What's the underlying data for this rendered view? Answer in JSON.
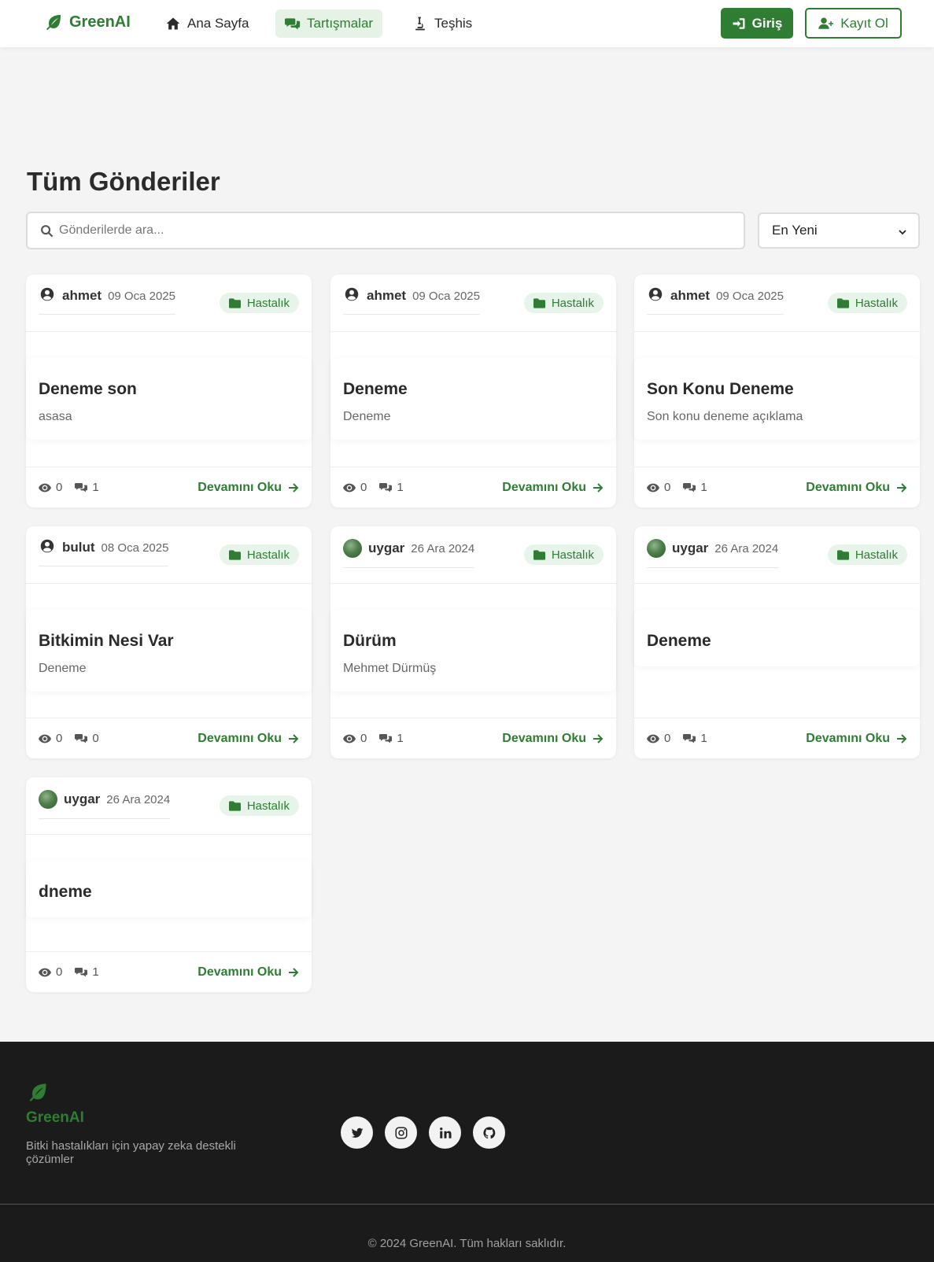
{
  "nav": {
    "brand": "GreenAI",
    "items": [
      {
        "label": "Ana Sayfa",
        "icon": "home-icon"
      },
      {
        "label": "Tartışmalar",
        "icon": "comments-icon",
        "active": true
      },
      {
        "label": "Teşhis",
        "icon": "microscope-icon"
      }
    ],
    "login_label": "Giriş",
    "register_label": "Kayıt Ol"
  },
  "page": {
    "title": "Tüm Gönderiler",
    "search_placeholder": "Gönderilerde ara...",
    "sort_selected": "En Yeni"
  },
  "posts": [
    {
      "author": "ahmet",
      "date": "09 Oca 2025",
      "category": "Hastalık",
      "title": "Deneme son",
      "desc": "asasa",
      "views": "0",
      "comments": "1",
      "read_more": "Devamını Oku",
      "avatar": "user-circle-icon"
    },
    {
      "author": "ahmet",
      "date": "09 Oca 2025",
      "category": "Hastalık",
      "title": "Deneme",
      "desc": "Deneme",
      "views": "0",
      "comments": "1",
      "read_more": "Devamını Oku",
      "avatar": "user-circle-icon"
    },
    {
      "author": "ahmet",
      "date": "09 Oca 2025",
      "category": "Hastalık",
      "title": "Son Konu Deneme",
      "desc": "Son konu deneme açıklama",
      "views": "0",
      "comments": "1",
      "read_more": "Devamını Oku",
      "avatar": "user-circle-icon"
    },
    {
      "author": "bulut",
      "date": "08 Oca 2025",
      "category": "Hastalık",
      "title": "Bitkimin Nesi Var",
      "desc": "Deneme",
      "views": "0",
      "comments": "0",
      "read_more": "Devamını Oku",
      "avatar": "user-circle-icon"
    },
    {
      "author": "uygar",
      "date": "26 Ara 2024",
      "category": "Hastalık",
      "title": "Dürüm",
      "desc": "Mehmet Dürmüş",
      "views": "0",
      "comments": "1",
      "read_more": "Devamını Oku",
      "avatar": "photo"
    },
    {
      "author": "uygar",
      "date": "26 Ara 2024",
      "category": "Hastalık",
      "title": "Deneme",
      "desc": "",
      "views": "0",
      "comments": "1",
      "read_more": "Devamını Oku",
      "avatar": "photo"
    },
    {
      "author": "uygar",
      "date": "26 Ara 2024",
      "category": "Hastalık",
      "title": "dneme",
      "desc": "",
      "views": "0",
      "comments": "1",
      "read_more": "Devamını Oku",
      "avatar": "photo"
    }
  ],
  "footer": {
    "brand": "GreenAI",
    "tagline": "Bitki hastalıkları için yapay zeka destekli çözümler",
    "social": [
      "twitter-icon",
      "instagram-icon",
      "linkedin-icon",
      "github-icon"
    ],
    "copyright": "© 2024 GreenAI. Tüm hakları saklıdır."
  },
  "colors": {
    "brand_green": "#2e7d32",
    "badge_bg": "#e6f4ea",
    "footer_bg": "#1b1b1b",
    "page_bg": "#f4f4f4"
  }
}
